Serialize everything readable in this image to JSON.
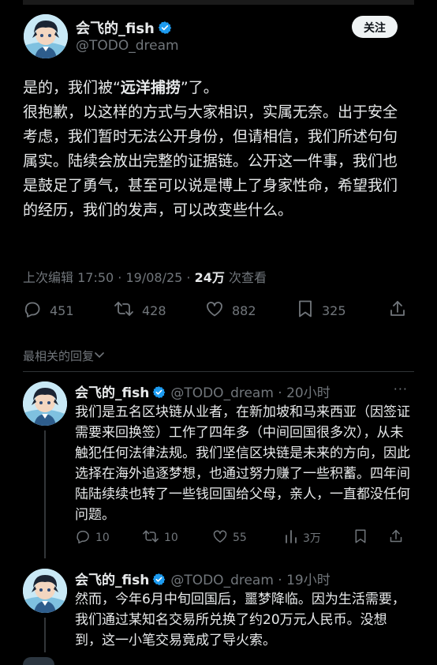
{
  "post": {
    "author_name": "会飞的_fish",
    "handle": "@TODO_dream",
    "follow_label": "关注",
    "paragraphs": [
      {
        "before": "是的，我们被“",
        "bold": "远洋捕捞",
        "after": "”了。"
      },
      {
        "text": "很抱歉，以这样的方式与大家相识，实属无奈。出于安全考虑，我们暂时无法公开身份，但请相信，我们所述句句属实。陆续会放出完整的证据链。公开这一件事，我们也是鼓足了勇气，甚至可以说是博上了身家性命，希望我们的经历，我们的发声，可以改变些什么。"
      }
    ],
    "meta": {
      "edited_prefix": "上次编辑 17:50 · 19/08/25 · ",
      "views_count": "24万",
      "views_label": " 次查看"
    },
    "actions": {
      "reply": {
        "icon": "reply-icon",
        "count": "451"
      },
      "repost": {
        "icon": "repost-icon",
        "count": "428"
      },
      "like": {
        "icon": "heart-icon",
        "count": "882"
      },
      "bookmark": {
        "icon": "bookmark-icon",
        "count": "325"
      },
      "share": {
        "icon": "share-icon"
      }
    }
  },
  "sort_label": "最相关的回复",
  "replies": [
    {
      "author_name": "会飞的_fish",
      "handle_time": "@TODO_dream · 20小时",
      "text": "我们是五名区块链从业者，在新加坡和马来西亚（因签证需要来回换签）工作了四年多（中间回国很多次），从未触犯任何法律法规。我们坚信区块链是未来的方向，因此选择在海外追逐梦想，也通过努力赚了一些积蓄。四年间陆陆续续也转了一些钱回国给父母，亲人，一直都没任何问题。",
      "actions": {
        "reply": "10",
        "repost": "10",
        "like": "55",
        "views": "3万"
      }
    },
    {
      "author_name": "会飞的_fish",
      "handle_time": "@TODO_dream · 19小时",
      "text": "然而，今年6月中旬回国后，噩梦降临。因为生活需要，我们通过某知名交易所兑换了约20万元人民币。没想到，这一小笔交易竟成了导火索。"
    }
  ],
  "colors": {
    "background": "#000000",
    "text": "#e7e9ea",
    "muted": "#71767b",
    "verified": "#1d9bf0",
    "divider": "#2f3336"
  }
}
